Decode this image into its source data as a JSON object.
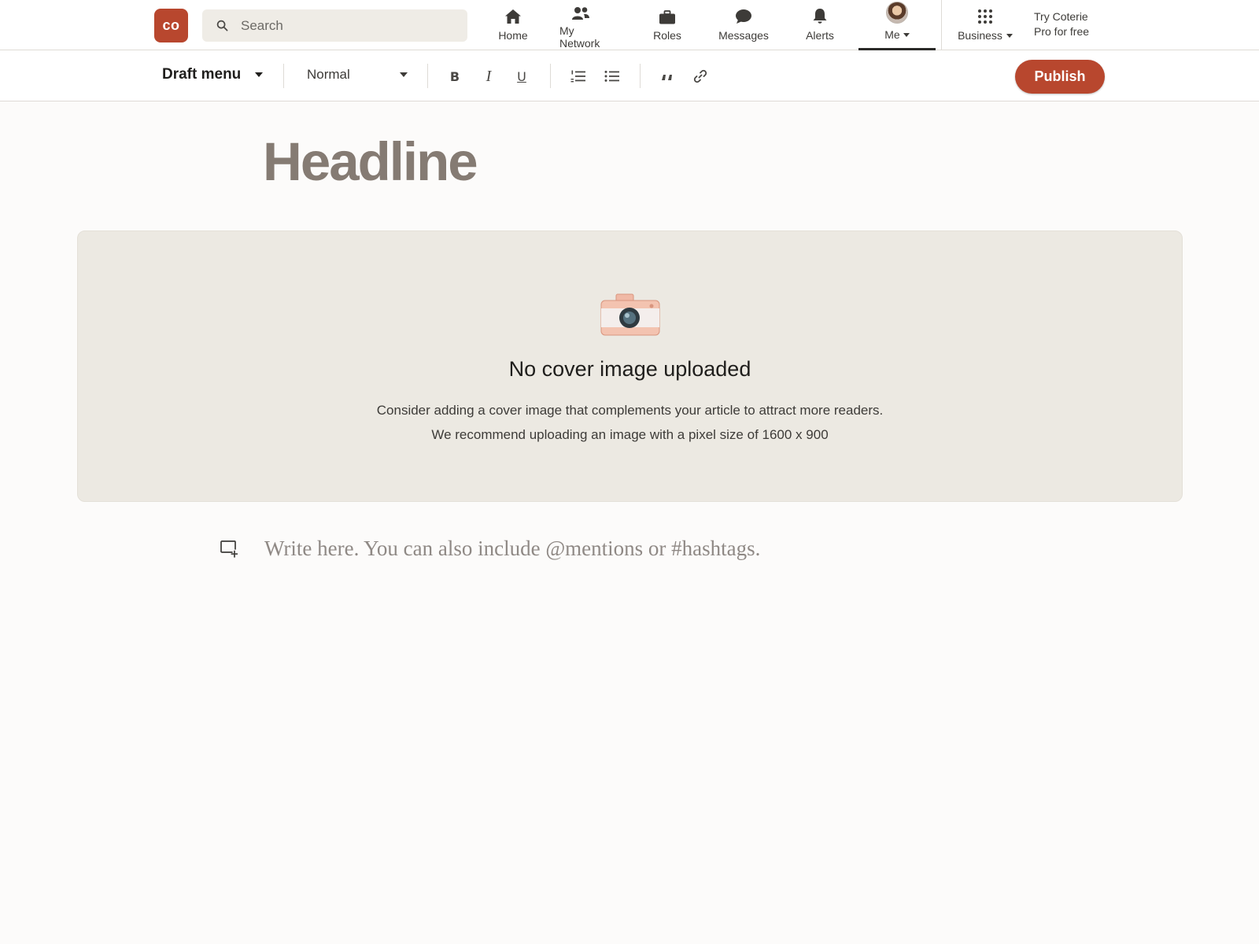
{
  "app": {
    "logo_text": "co"
  },
  "search": {
    "placeholder": "Search",
    "value": ""
  },
  "nav": {
    "home": "Home",
    "network": "My Network",
    "roles": "Roles",
    "messages": "Messages",
    "alerts": "Alerts",
    "me": "Me",
    "business": "Business",
    "try_pro": "Try Coterie\nPro for free"
  },
  "toolbar": {
    "draft_menu": "Draft menu",
    "text_style": "Normal",
    "bold": "B",
    "italic": "I",
    "underline": "U",
    "publish": "Publish"
  },
  "editor": {
    "headline_placeholder": "Headline",
    "body_placeholder": "Write here. You can also include @mentions or #hashtags."
  },
  "cover": {
    "title": "No cover image uploaded",
    "desc_line1": "Consider adding a cover image that complements your article to attract more readers.",
    "desc_line2": "We recommend uploading an image with a pixel size of 1600 x 900"
  },
  "colors": {
    "brand": "#b8472e",
    "headline": "#857b73",
    "cover_bg": "#ece9e2"
  },
  "icons": {
    "home": "home-icon",
    "network": "people-icon",
    "roles": "briefcase-icon",
    "messages": "chat-bubble-icon",
    "alerts": "bell-icon",
    "business": "grid-icon",
    "search": "search-icon",
    "camera": "camera-icon"
  }
}
